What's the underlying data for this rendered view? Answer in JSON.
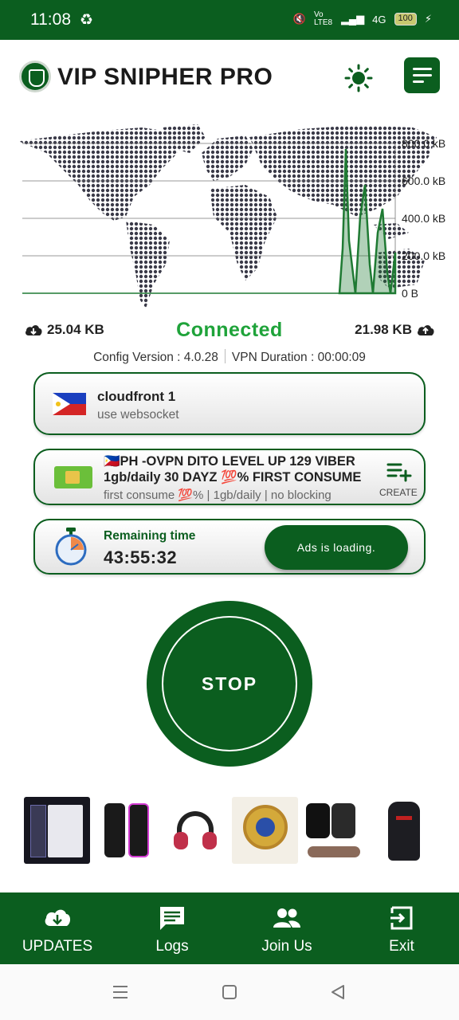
{
  "status_bar": {
    "time": "11:08",
    "network": "Vo LTE8",
    "signal_type": "4G",
    "battery": "100"
  },
  "header": {
    "app_title": "VIP SNIPHER PRO",
    "logo_icon": "shield-logo-icon",
    "theme_icon": "sun-icon",
    "menu_icon": "menu-lines-icon"
  },
  "traffic_graph": {
    "y_ticks": [
      "800.0 kB",
      "600.0 kB",
      "400.0 kB",
      "200.0 kB",
      "0 B"
    ],
    "ylim": [
      0,
      800
    ],
    "series_color": "#1f7a33",
    "background": "world-map-dots"
  },
  "stats": {
    "download": "25.04 KB",
    "status": "Connected",
    "upload": "21.98 KB"
  },
  "meta": {
    "config_version": "Config Version : 4.0.28",
    "vpn_duration": "VPN Duration : 00:00:09"
  },
  "server_card": {
    "title": "cloudfront 1",
    "subtitle": "use websocket",
    "flag": "philippines-flag"
  },
  "config_card": {
    "title": "🇵🇭PH -OVPN DITO LEVEL UP 129 VIBER 1gb/daily 30 DAYZ 💯% FIRST CONSUME",
    "subtitle": "first consume 💯% | 1gb/daily | no blocking",
    "create_label": "CREATE"
  },
  "time_card": {
    "label": "Remaining time",
    "value": "43:55:32",
    "ads_button": "Ads is loading."
  },
  "stop_button": {
    "label": "STOP"
  },
  "ads": [
    "power-bank",
    "party-speaker",
    "headphones",
    "gold-watch",
    "smart-watches",
    "backpack"
  ],
  "bottom_nav": [
    {
      "label": "UPDATES",
      "icon": "cloud-download-icon"
    },
    {
      "label": "Logs",
      "icon": "message-icon"
    },
    {
      "label": "Join Us",
      "icon": "people-icon"
    },
    {
      "label": "Exit",
      "icon": "exit-icon"
    }
  ],
  "colors": {
    "brand_green": "#0b5e1f",
    "connected_green": "#1fa33a"
  }
}
